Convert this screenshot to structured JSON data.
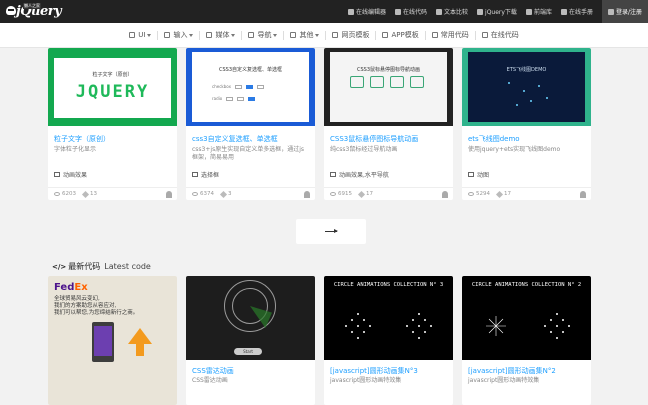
{
  "topbar": {
    "logo_text": "jQuery",
    "logo_tag": "懒人之家",
    "links": [
      "在线编辑器",
      "在线代码",
      "文本比较",
      "jQuery下载",
      "前端库",
      "在线手册",
      "登录/注册"
    ]
  },
  "catnav": {
    "items": [
      "UI",
      "输入",
      "媒体",
      "导航",
      "其他",
      "网页模板",
      "APP模板",
      "常用代码",
      "在线代码"
    ]
  },
  "row1": [
    {
      "thumb_title": "粒子文字（原创）",
      "thumb_big": "JQUERY",
      "title": "粒子文字（原创）",
      "desc": "字体粒子化显示",
      "tag": "动画效果",
      "views": "6203",
      "likes": "13"
    },
    {
      "thumb_title": "CSS3自定义复选框、单选框",
      "thumb_row1": "checkbox",
      "thumb_row2": "radio",
      "title": "css3自定义复选框、单选框",
      "desc": "css3+js原生实现自定义单多选框，通过js框架，简易易用",
      "tag": "选择框",
      "views": "6374",
      "likes": "3"
    },
    {
      "thumb_title": "CSS3鼠标悬停图标导航动画",
      "title": "CSS3鼠标悬停图标导航动画",
      "desc": "纯css3鼠标经过导航动画",
      "tag": "动画效果,水平导航",
      "views": "6915",
      "likes": "17"
    },
    {
      "thumb_title": "ETS飞线图DEMO",
      "title": "ets飞线图demo",
      "desc": "使用jquery+ets实现飞线图demo",
      "tag": "动图",
      "views": "5294",
      "likes": "17"
    }
  ],
  "more_button": "⟶",
  "latest": {
    "icon": "</>",
    "title_cn": "最新代码",
    "title_en": "Latest code"
  },
  "row2": [
    {
      "ad_brand_a": "Fed",
      "ad_brand_b": "Ex",
      "ad_line1": "全球贸易风云变幻,",
      "ad_line2": "我们的方案助您从容应对,",
      "ad_line3": "我们可以帮您,为您缔结新行之商。"
    },
    {
      "btn": "Start",
      "title": "CSS雷达动画",
      "desc": "CSS雷达动画"
    },
    {
      "thumb_head": "CIRCLE ANIMATIONS COLLECTION N° 3",
      "title": "[javascript]圆形动画集N°3",
      "desc": "javascript圆形动画特效集"
    },
    {
      "thumb_head": "CIRCLE ANIMATIONS COLLECTION N° 2",
      "title": "[javascript]圆形动画集N°2",
      "desc": "javascript圆形动画特效集"
    }
  ],
  "colors": {
    "accent": "#1e9fff",
    "topbar": "#222222",
    "green": "#13a84f",
    "blue": "#1a5bd6",
    "teal": "#2fb38c"
  }
}
